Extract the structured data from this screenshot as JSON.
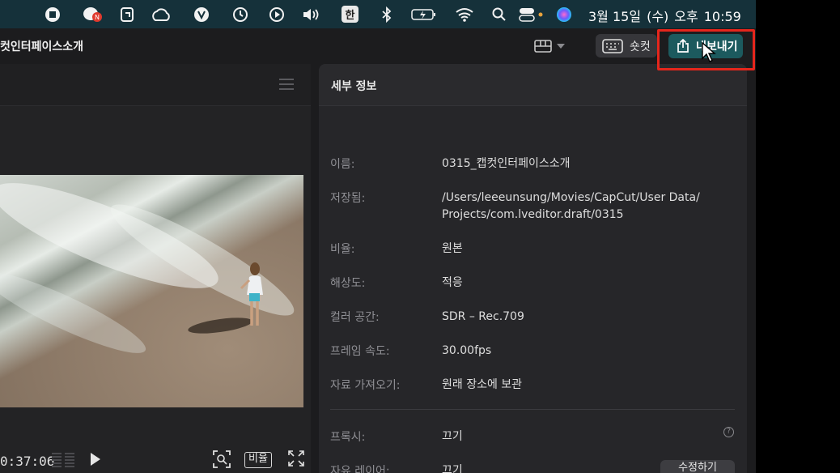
{
  "menubar": {
    "ko_input": "한",
    "clock": {
      "date": "3월 15일",
      "weekday": "(수)",
      "ampm": "오후",
      "time": "10:59"
    }
  },
  "app": {
    "project_title": "컷인터페이스소개",
    "shortcut_label": "숏컷",
    "export_label": "내보내기"
  },
  "player": {
    "timecode": "0:37:06",
    "ratio_label": "비율"
  },
  "details": {
    "title": "세부 정보",
    "rows": [
      {
        "label": "이름:",
        "value": "0315_캡컷인터페이스소개"
      },
      {
        "label": "저장됨:",
        "value": "/Users/leeeunsung/Movies/CapCut/User Data/ Projects/com.lveditor.draft/0315"
      },
      {
        "label": "비율:",
        "value": "원본"
      },
      {
        "label": "해상도:",
        "value": "적응"
      },
      {
        "label": "컬러 공간:",
        "value": "SDR – Rec.709"
      },
      {
        "label": "프레임 속도:",
        "value": "30.00fps"
      },
      {
        "label": "자료 가져오기:",
        "value": "원래 장소에 보관"
      },
      {
        "label": "프록시:",
        "value": "끄기"
      },
      {
        "label": "자유 레이어:",
        "value": "끄기"
      }
    ],
    "edit_label": "수정하기"
  },
  "colors": {
    "menubar_bg": "#15313a",
    "export_bg": "#1c5a5e",
    "highlight": "#e5261c"
  }
}
